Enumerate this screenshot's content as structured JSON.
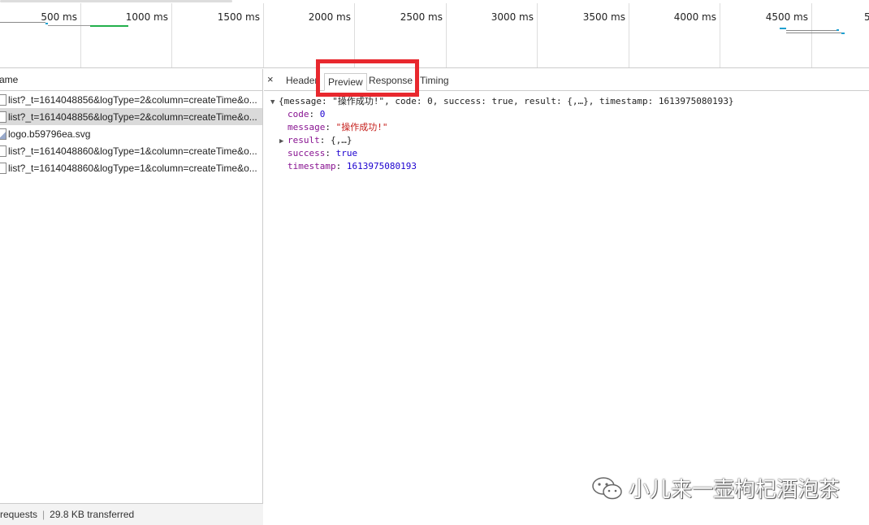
{
  "timeline": {
    "ticks": [
      "500 ms",
      "1000 ms",
      "1500 ms",
      "2000 ms",
      "2500 ms",
      "3000 ms",
      "3500 ms",
      "4000 ms",
      "4500 ms",
      "5"
    ]
  },
  "list": {
    "header_label": "ame",
    "requests": [
      {
        "name": "list?_t=1614048856&logType=2&column=createTime&o...",
        "selected": false,
        "type": "doc"
      },
      {
        "name": "list?_t=1614048856&logType=2&column=createTime&o...",
        "selected": true,
        "type": "doc"
      },
      {
        "name": "logo.b59796ea.svg",
        "selected": false,
        "type": "img"
      },
      {
        "name": "list?_t=1614048860&logType=1&column=createTime&o...",
        "selected": false,
        "type": "doc"
      },
      {
        "name": "list?_t=1614048860&logType=1&column=createTime&o...",
        "selected": false,
        "type": "doc"
      }
    ],
    "status": {
      "requests": "requests",
      "transferred": "29.8 KB transferred"
    }
  },
  "tabs": {
    "close": "×",
    "headers": "Header",
    "preview": "Preview",
    "response": "Response",
    "timing": "Timing"
  },
  "preview": {
    "summary": "{message: \"操作成功!\", code: 0, success: true, result: {,…}, timestamp: 1613975080193}",
    "code_key": "code",
    "code_val": "0",
    "message_key": "message",
    "message_val": "\"操作成功!\"",
    "result_key": "result",
    "result_val": "{,…}",
    "success_key": "success",
    "success_val": "true",
    "timestamp_key": "timestamp",
    "timestamp_val": "1613975080193"
  },
  "watermark": {
    "text": "小儿来一壶枸杞酒泡茶"
  },
  "colors": {
    "highlight": "#e8282e",
    "selected_row": "#dadada"
  }
}
